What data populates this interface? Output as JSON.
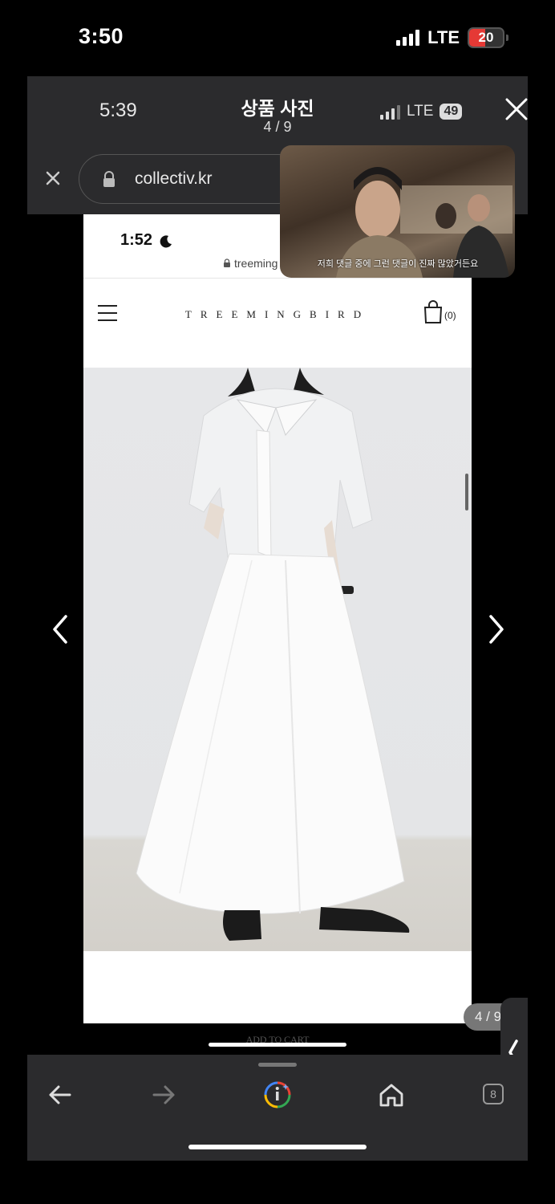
{
  "status_bar": {
    "time": "3:50",
    "network": "LTE",
    "battery": "20"
  },
  "viewer": {
    "inner_time": "5:39",
    "title": "상품 사진",
    "counter": "4 / 9",
    "inner_network": "LTE",
    "inner_battery": "49",
    "url": "collectiv.kr"
  },
  "video": {
    "caption": "저희 댓글 중에 그런 댓글이 진짜 많았거든요"
  },
  "page": {
    "time": "1:52",
    "url": "treeming",
    "brand": "TREEMINGBIRD",
    "cart_count": "(0)",
    "add_to_cart": "ADD TO CART"
  },
  "photo_counter": "4 / 9",
  "toolbar": {
    "tabs_count": "8"
  },
  "colors": {
    "panel": "#2b2b2d",
    "battery_low": "#e53935",
    "background": "#000000"
  }
}
